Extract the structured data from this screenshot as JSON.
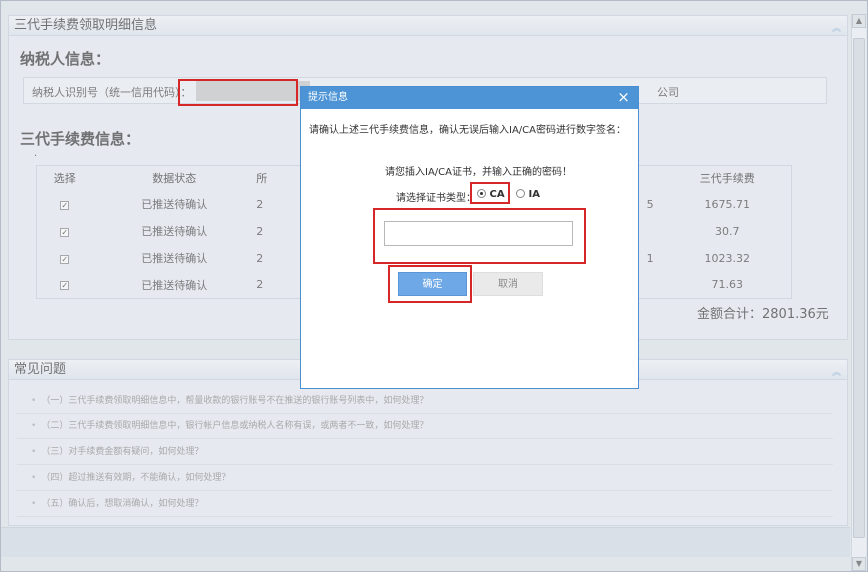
{
  "detail_panel": {
    "title": "三代手续费领取明细信息"
  },
  "taxpayer": {
    "section_title": "纳税人信息：",
    "id_label": "纳税人识别号（统一信用代码）：",
    "id_value": "",
    "company_tail": "公司"
  },
  "fees": {
    "section_title": "三代手续费信息：",
    "dot": ".",
    "columns": [
      "选择",
      "数据状态",
      "所",
      "三代手续费"
    ],
    "rows": [
      {
        "checked": "✓",
        "status": "已推送待确认",
        "p": "2",
        "frag": "5",
        "fee": "1675.71"
      },
      {
        "checked": "✓",
        "status": "已推送待确认",
        "p": "2",
        "frag": "",
        "fee": "30.7"
      },
      {
        "checked": "✓",
        "status": "已推送待确认",
        "p": "2",
        "frag": "1",
        "fee": "1023.32"
      },
      {
        "checked": "✓",
        "status": "已推送待确认",
        "p": "2",
        "frag": "",
        "fee": "71.63"
      }
    ],
    "total_text": "金额合计：2801.36元"
  },
  "faq_panel": {
    "title": "常见问题",
    "items": [
      "（一）三代手续费领取明细信息中，帮量收款的银行账号不在推送的银行账号列表中，如何处理？",
      "（二）三代手续费领取明细信息中，银行帐户信息或纳税人名称有误，或两者不一致，如何处理？",
      "（三）对手续费金额有疑问，如何处理？",
      "（四）超过推送有效期，不能确认，如何处理？",
      "（五）确认后，想取消确认，如何处理？"
    ]
  },
  "dialog": {
    "title": "提示信息",
    "close": "×",
    "message": "请确认上述三代手续费信息，确认无误后输入IA/CA密码进行数字签名：",
    "prompt": "请您插入IA/CA证书，并输入正确的密码！",
    "cert_type_label": "请选择证书类型：",
    "option_ca": "CA",
    "option_ia": "IA",
    "password_value": "",
    "ok_label": "确定",
    "cancel_label": "取消"
  },
  "colors": {
    "dialog_header": "#4d94d6",
    "ok_button": "#6fa8e6",
    "highlight": "#d62728"
  },
  "icons": {
    "collapse": "chevron-up-icon",
    "checkbox": "checkbox-icon",
    "close": "close-icon"
  }
}
